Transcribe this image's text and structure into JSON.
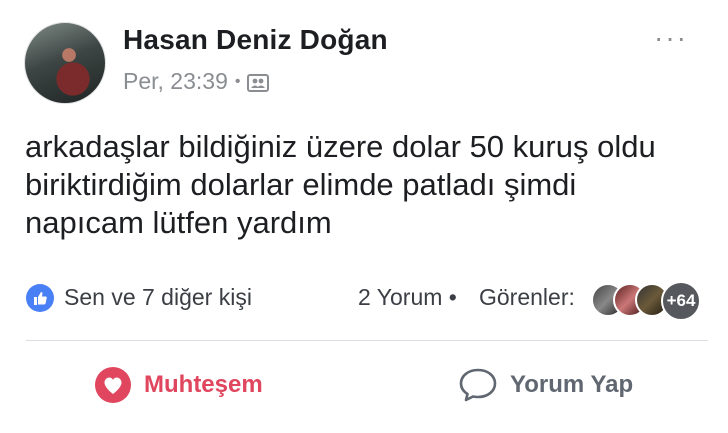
{
  "post": {
    "author": "Hasan Deniz Doğan",
    "timestamp": "Per, 23:39",
    "separator": "•",
    "privacy_icon": "friends-privacy-icon",
    "more_label": "···",
    "text_lines": [
      "arkadaşlar bildiğiniz üzere dolar 50 kuruş oldu",
      "biriktirdiğim dolarlar elimde patladı şimdi",
      "napıcam lütfen yardım"
    ]
  },
  "stats": {
    "likes": "Sen ve 7 diğer kişi",
    "comments": "2 Yorum",
    "separator": "•",
    "viewers_label": "Görenler:",
    "viewers_more": "+64"
  },
  "actions": {
    "love_label": "Muhteşem",
    "comment_label": "Yorum Yap"
  },
  "colors": {
    "like_blue": "#4a80f5",
    "love_red": "#e0465e",
    "muted": "#8a8d91"
  }
}
